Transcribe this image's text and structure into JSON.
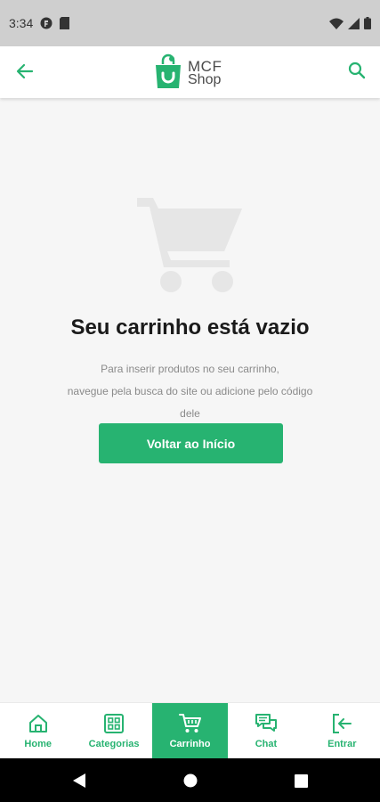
{
  "status_bar": {
    "time": "3:34",
    "icons": [
      "app-notification-icon",
      "sim-card-icon",
      "wifi-icon",
      "signal-icon",
      "battery-icon"
    ]
  },
  "header": {
    "logo_line1": "MCF",
    "logo_line2": "Shop",
    "back_icon": "arrow-left-icon",
    "search_icon": "search-icon"
  },
  "empty_cart": {
    "icon": "shopping-cart-icon",
    "title": "Seu carrinho está vazio",
    "description_lines": [
      "Para inserir produtos no seu carrinho,",
      "navegue pela busca do site ou adicione pelo código",
      "dele"
    ],
    "button_label": "Voltar ao Início"
  },
  "bottom_nav": {
    "items": [
      {
        "label": "Home",
        "icon": "home-icon",
        "active": false
      },
      {
        "label": "Categorias",
        "icon": "categories-grid-icon",
        "active": false
      },
      {
        "label": "Carrinho",
        "icon": "cart-icon",
        "active": true
      },
      {
        "label": "Chat",
        "icon": "chat-icon",
        "active": false
      },
      {
        "label": "Entrar",
        "icon": "login-icon",
        "active": false
      }
    ]
  },
  "colors": {
    "brand_green": "#27b371",
    "background": "#f6f6f6",
    "status_bar": "#cfcfcf"
  }
}
